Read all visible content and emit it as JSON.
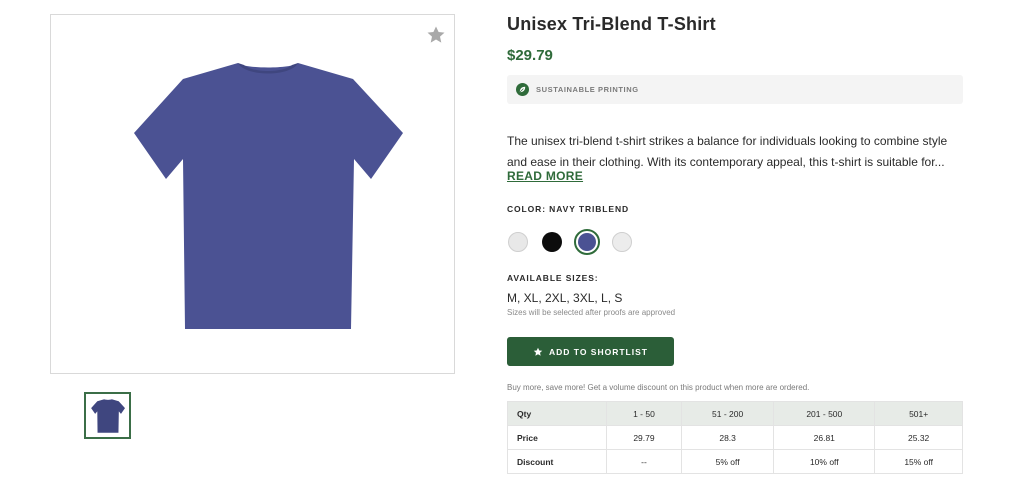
{
  "product": {
    "title": "Unisex Tri-Blend T-Shirt",
    "price": "$29.79",
    "shirt_color_hex": "#4b5293",
    "favorite_icon": "star-icon"
  },
  "badge": {
    "icon": "leaf-icon",
    "text": "SUSTAINABLE PRINTING"
  },
  "description": {
    "text": "The unisex tri-blend t-shirt strikes a balance for individuals looking to combine style and ease in their clothing. With its contemporary appeal, this t-shirt is suitable for...",
    "read_more": "READ MORE"
  },
  "color": {
    "label": "COLOR: NAVY TRIBLEND",
    "swatches": [
      {
        "name": "light-gray",
        "hex": "#e8e8e8",
        "selected": false
      },
      {
        "name": "black",
        "hex": "#0c0c0c",
        "selected": false
      },
      {
        "name": "navy-triblend",
        "hex": "#4b5293",
        "selected": true
      },
      {
        "name": "white",
        "hex": "#ececec",
        "selected": false
      }
    ]
  },
  "sizes": {
    "label": "AVAILABLE SIZES:",
    "value": "M, XL, 2XL, 3XL, L, S",
    "note": "Sizes will be selected after proofs are approved"
  },
  "shortlist": {
    "label": "ADD TO SHORTLIST",
    "icon": "star-icon"
  },
  "volume": {
    "note": "Buy more, save more! Get a volume discount on this product when more are ordered.",
    "headers": [
      "Qty",
      "1 - 50",
      "51 - 200",
      "201 - 500",
      "501+"
    ],
    "price_row": [
      "Price",
      "29.79",
      "28.3",
      "26.81",
      "25.32"
    ],
    "discount_row": [
      "Discount",
      "--",
      "5% off",
      "10% off",
      "15% off"
    ]
  },
  "colors": {
    "accent_green": "#2f6b3a",
    "button_green": "#2b5e38"
  }
}
